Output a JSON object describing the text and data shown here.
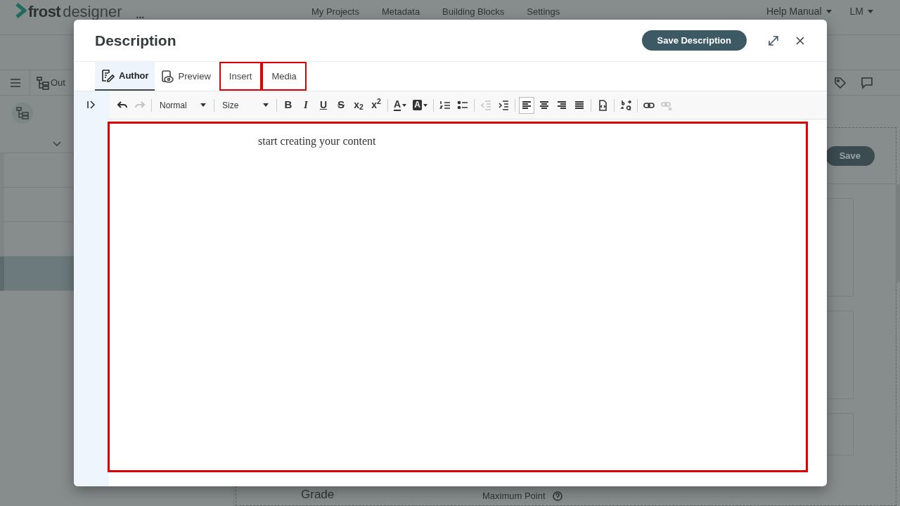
{
  "app": {
    "logo": {
      "part1": "frost",
      "part2": "designer"
    },
    "more": "...",
    "nav": [
      "My Projects",
      "Metadata",
      "Building Blocks",
      "Settings"
    ],
    "help": "Help Manual",
    "user": "LM",
    "outline_tab": "Out",
    "outline_rows": [
      {
        "selected": false
      },
      {
        "selected": false
      },
      {
        "selected": false
      },
      {
        "selected": true
      }
    ],
    "save": "Save",
    "field_labels": [
      "Grade",
      "Maximum Point"
    ]
  },
  "dialog": {
    "title": "Description",
    "save_button": "Save Description",
    "tabs": [
      {
        "label": "Author",
        "selected": true,
        "highlighted": false
      },
      {
        "label": "Preview",
        "selected": false,
        "highlighted": false
      },
      {
        "label": "Insert",
        "selected": false,
        "highlighted": true
      },
      {
        "label": "Media",
        "selected": false,
        "highlighted": true
      }
    ],
    "toolbar": [
      {
        "kind": "undo",
        "disabled": false
      },
      {
        "kind": "redo",
        "disabled": true
      },
      {
        "kind": "separator"
      },
      {
        "kind": "dropdown",
        "label": "Normal"
      },
      {
        "kind": "separator"
      },
      {
        "kind": "dropdown",
        "label": "Size"
      },
      {
        "kind": "separator"
      },
      {
        "kind": "bold",
        "label": "B",
        "disabled": false
      },
      {
        "kind": "italic",
        "label": "I",
        "disabled": false
      },
      {
        "kind": "underline",
        "label": "U",
        "disabled": false
      },
      {
        "kind": "strike",
        "label": "S",
        "disabled": false
      },
      {
        "kind": "script",
        "label": "x$_{2}$",
        "disabled": false
      },
      {
        "kind": "script",
        "label": "x$^{2}$",
        "disabled": false
      },
      {
        "kind": "separator"
      },
      {
        "kind": "text-color",
        "label": "A",
        "disabled": false
      },
      {
        "kind": "bg-color",
        "label": "A",
        "disabled": false
      },
      {
        "kind": "separator"
      },
      {
        "kind": "ordered-list",
        "disabled": false
      },
      {
        "kind": "bullet-list",
        "disabled": false
      },
      {
        "kind": "separator"
      },
      {
        "kind": "outdent",
        "disabled": true
      },
      {
        "kind": "indent",
        "disabled": false
      },
      {
        "kind": "separator"
      },
      {
        "kind": "align-left",
        "disabled": false,
        "selected": true
      },
      {
        "kind": "align-center",
        "disabled": false,
        "selected": false
      },
      {
        "kind": "align-right",
        "disabled": false,
        "selected": false
      },
      {
        "kind": "justify",
        "disabled": false,
        "selected": false
      },
      {
        "kind": "separator"
      },
      {
        "kind": "source",
        "disabled": false
      },
      {
        "kind": "separator"
      },
      {
        "kind": "text-direction",
        "disabled": false
      },
      {
        "kind": "separator"
      },
      {
        "kind": "link",
        "disabled": false
      },
      {
        "kind": "unlink",
        "disabled": true
      }
    ],
    "editor": {
      "placeholder": "start creating your content",
      "highlighted": true
    }
  }
}
